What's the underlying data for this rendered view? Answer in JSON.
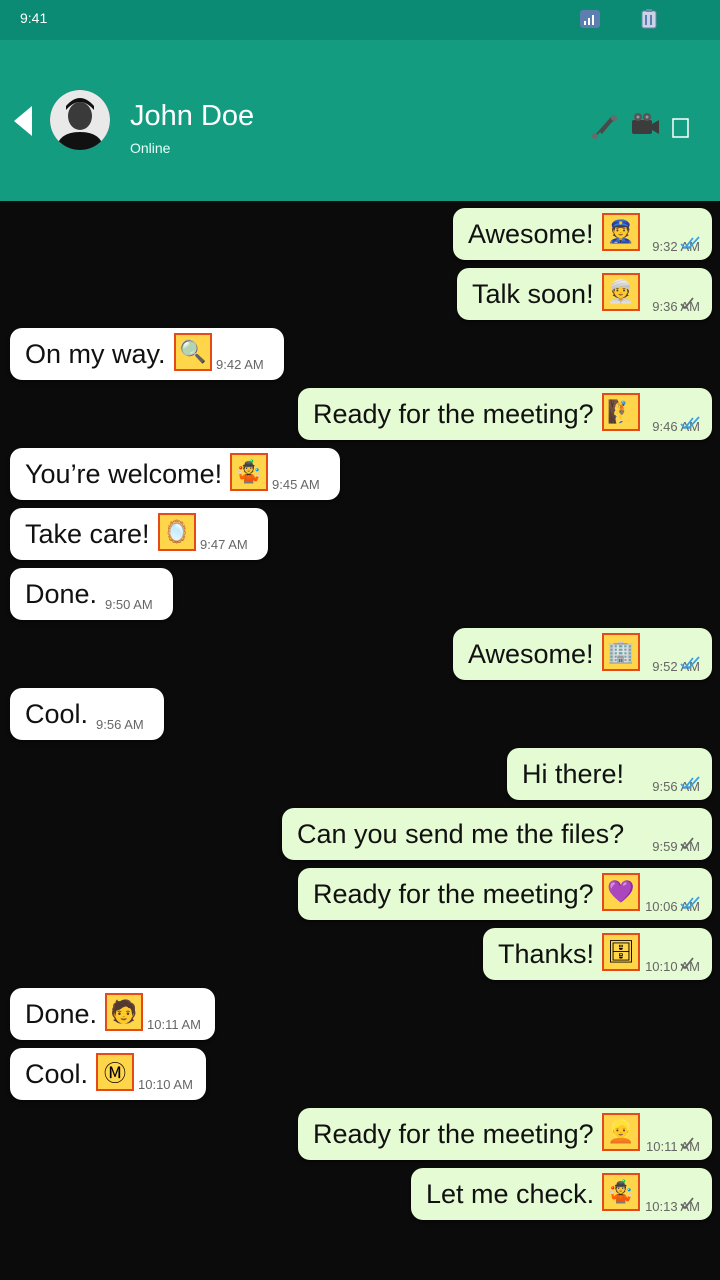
{
  "status": {
    "time": "9:41"
  },
  "header": {
    "name": "John Doe",
    "status": "Online"
  },
  "messages": [
    {
      "dir": "out",
      "text": "Awesome!",
      "time": "9:32 AM",
      "emoji": "police-officer",
      "ticks": "read"
    },
    {
      "dir": "out",
      "text": "Talk soon!",
      "time": "9:36 AM",
      "emoji": "man-with-turban",
      "ticks": "sent"
    },
    {
      "dir": "in",
      "text": "On my way.",
      "time": "9:42 AM",
      "emoji": "magnifier"
    },
    {
      "dir": "out",
      "text": "Ready for the meeting?",
      "time": "9:46 AM",
      "emoji": "person-climbing",
      "ticks": "read"
    },
    {
      "dir": "in",
      "text": "You’re welcome!",
      "time": "9:45 AM",
      "emoji": "juggler"
    },
    {
      "dir": "in",
      "text": "Take care!",
      "time": "9:47 AM",
      "emoji": "mirror"
    },
    {
      "dir": "in",
      "text": "Done.",
      "time": "9:50 AM"
    },
    {
      "dir": "out",
      "text": "Awesome!",
      "time": "9:52 AM",
      "emoji": "office-building",
      "ticks": "read"
    },
    {
      "dir": "in",
      "text": "Cool.",
      "time": "9:56 AM"
    },
    {
      "dir": "out",
      "text": "Hi there!",
      "time": "9:56 AM",
      "ticks": "read"
    },
    {
      "dir": "out",
      "text": "Can you send me the files?",
      "time": "9:59 AM",
      "ticks": "sent"
    },
    {
      "dir": "out",
      "text": "Ready for the meeting?",
      "time": "10:06 AM",
      "emoji": "purple-heart",
      "ticks": "read"
    },
    {
      "dir": "out",
      "text": "Thanks!",
      "time": "10:10 AM",
      "emoji": "file-cabinet",
      "ticks": "sent"
    },
    {
      "dir": "in",
      "text": "Done.",
      "time": "10:11 AM",
      "emoji": "person-bald"
    },
    {
      "dir": "in",
      "text": "Cool.",
      "time": "10:10 AM",
      "emoji": "letter-m"
    },
    {
      "dir": "out",
      "text": "Ready for the meeting?",
      "time": "10:11 AM",
      "emoji": "woman-blond",
      "ticks": "sent"
    },
    {
      "dir": "out",
      "text": "Let me check.",
      "time": "10:13 AM",
      "emoji": "man-juggling",
      "ticks": "sent"
    }
  ]
}
